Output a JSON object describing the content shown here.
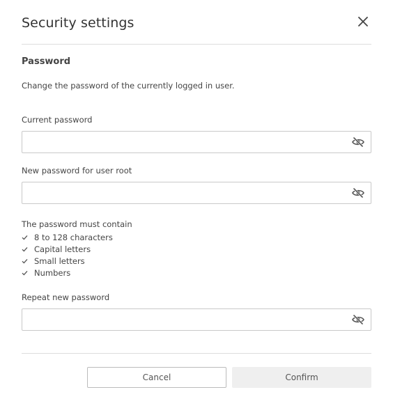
{
  "dialog": {
    "title": "Security settings",
    "close_icon": "close-icon"
  },
  "section": {
    "heading": "Password",
    "description": "Change the password of the currently logged in user."
  },
  "fields": {
    "current": {
      "label": "Current password",
      "value": "",
      "toggle_icon": "eye-slash-icon"
    },
    "new": {
      "label": "New password for user root",
      "value": "",
      "toggle_icon": "eye-slash-icon"
    },
    "repeat": {
      "label": "Repeat new password",
      "value": "",
      "toggle_icon": "eye-slash-icon"
    }
  },
  "requirements": {
    "title": "The password must contain",
    "check_icon": "checkmark-icon",
    "items": [
      "8 to 128 characters",
      "Capital letters",
      "Small letters",
      "Numbers"
    ]
  },
  "buttons": {
    "cancel_label": "Cancel",
    "confirm_label": "Confirm"
  },
  "colors": {
    "text": "#333333",
    "divider": "#dddddd",
    "field_border": "#c9c9c9",
    "confirm_bg": "#efefef"
  }
}
